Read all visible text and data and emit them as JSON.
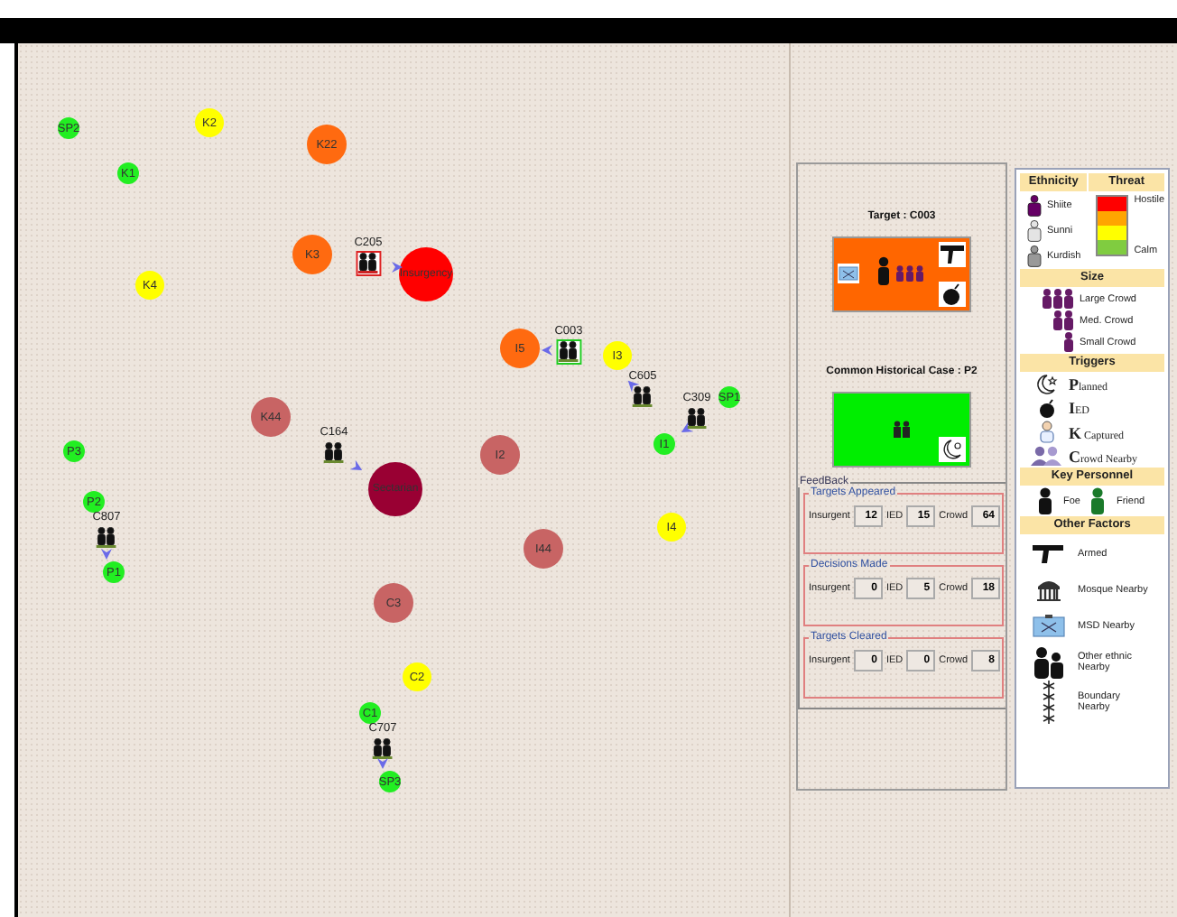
{
  "map": {
    "nodes": [
      {
        "label": "SP2",
        "color": "#22ee22",
        "kind": "small"
      },
      {
        "label": "K2",
        "color": "#ffff00",
        "kind": "medium"
      },
      {
        "label": "K1",
        "color": "#22ee22",
        "kind": "small"
      },
      {
        "label": "K22",
        "color": "#ff6a10",
        "kind": "large"
      },
      {
        "label": "K3",
        "color": "#ff6a10",
        "kind": "large"
      },
      {
        "label": "K4",
        "color": "#ffff00",
        "kind": "medium"
      },
      {
        "label": "Insurgency",
        "color": "#ff0000",
        "kind": "huge"
      },
      {
        "label": "I5",
        "color": "#ff6a10",
        "kind": "large"
      },
      {
        "label": "I3",
        "color": "#ffff00",
        "kind": "medium"
      },
      {
        "label": "SP1",
        "color": "#22ee22",
        "kind": "small"
      },
      {
        "label": "I1",
        "color": "#22ee22",
        "kind": "small"
      },
      {
        "label": "K44",
        "color": "#c86464",
        "kind": "large"
      },
      {
        "label": "I2",
        "color": "#c86464",
        "kind": "large"
      },
      {
        "label": "Sectarian",
        "color": "#990033",
        "kind": "huge"
      },
      {
        "label": "P3",
        "color": "#22ee22",
        "kind": "small"
      },
      {
        "label": "P2",
        "color": "#22ee22",
        "kind": "small"
      },
      {
        "label": "P1",
        "color": "#22ee22",
        "kind": "small"
      },
      {
        "label": "I4",
        "color": "#ffff00",
        "kind": "medium"
      },
      {
        "label": "I44",
        "color": "#c86464",
        "kind": "large"
      },
      {
        "label": "C3",
        "color": "#c86464",
        "kind": "large"
      },
      {
        "label": "C2",
        "color": "#ffff00",
        "kind": "medium"
      },
      {
        "label": "C1",
        "color": "#22ee22",
        "kind": "small"
      },
      {
        "label": "SP3",
        "color": "#22ee22",
        "kind": "small"
      }
    ],
    "crowds": [
      {
        "label": "C205",
        "alert": true,
        "selected": false
      },
      {
        "label": "C003",
        "alert": false,
        "selected": true
      },
      {
        "label": "C605",
        "alert": false,
        "selected": false
      },
      {
        "label": "C309",
        "alert": false,
        "selected": false
      },
      {
        "label": "C164",
        "alert": false,
        "selected": false
      },
      {
        "label": "C807",
        "alert": false,
        "selected": false
      },
      {
        "label": "C707",
        "alert": false,
        "selected": false
      }
    ]
  },
  "cases": [
    {
      "title": "Target : C003",
      "color": "#ff6600",
      "kind": "target"
    },
    {
      "title": "Common Historical Case : P2",
      "color": "#00ee00",
      "kind": "historical"
    }
  ],
  "feedback": {
    "title": "FeedBack",
    "groups": [
      {
        "title": "Targets Appeared",
        "counts": [
          {
            "label": "Insurgent",
            "value": "12"
          },
          {
            "label": "IED",
            "value": "15"
          },
          {
            "label": "Crowd",
            "value": "64"
          }
        ]
      },
      {
        "title": "Decisions Made",
        "counts": [
          {
            "label": "Insurgent",
            "value": "0"
          },
          {
            "label": "IED",
            "value": "5"
          },
          {
            "label": "Crowd",
            "value": "18"
          }
        ]
      },
      {
        "title": "Targets Cleared",
        "counts": [
          {
            "label": "Insurgent",
            "value": "0"
          },
          {
            "label": "IED",
            "value": "0"
          },
          {
            "label": "Crowd",
            "value": "8"
          }
        ]
      }
    ]
  },
  "legend": {
    "ethnicity": {
      "title": "Ethnicity",
      "items": [
        {
          "label": "Shiite",
          "color": "#660066"
        },
        {
          "label": "Sunni",
          "color": "#e4e4e4"
        },
        {
          "label": "Kurdish",
          "color": "#999999"
        }
      ]
    },
    "threat": {
      "title": "Threat",
      "levels": [
        {
          "color": "#ff0000"
        },
        {
          "color": "#ffa500"
        },
        {
          "color": "#ffff00"
        },
        {
          "color": "#80cc40"
        }
      ],
      "top": "Hostile",
      "bottom": "Calm"
    },
    "size": {
      "title": "Size",
      "items": [
        {
          "label": "Large Crowd",
          "kind": "large"
        },
        {
          "label": "Med. Crowd",
          "kind": "medium"
        },
        {
          "label": "Small Crowd",
          "kind": "small"
        }
      ]
    },
    "triggers": {
      "title": "Triggers",
      "items": [
        {
          "label": "Planned",
          "kind": "planned"
        },
        {
          "label": "IED",
          "kind": "ied"
        },
        {
          "label": "K Captured",
          "kind": "captured"
        },
        {
          "label": "Crowd Nearby",
          "kind": "crowd"
        }
      ]
    },
    "personnel": {
      "title": "Key Personnel",
      "items": [
        {
          "label": "Foe",
          "kind": "foe"
        },
        {
          "label": "Friend",
          "kind": "friend"
        }
      ]
    },
    "factors": {
      "title": "Other Factors",
      "items": [
        {
          "label": "Armed",
          "kind": "armed"
        },
        {
          "label": "Mosque Nearby",
          "kind": "mosque"
        },
        {
          "label": "MSD Nearby",
          "kind": "msd"
        },
        {
          "label": "Other ethnic Nearby",
          "kind": "ethnic"
        },
        {
          "label": "Boundary Nearby",
          "kind": "boundary"
        }
      ]
    }
  }
}
